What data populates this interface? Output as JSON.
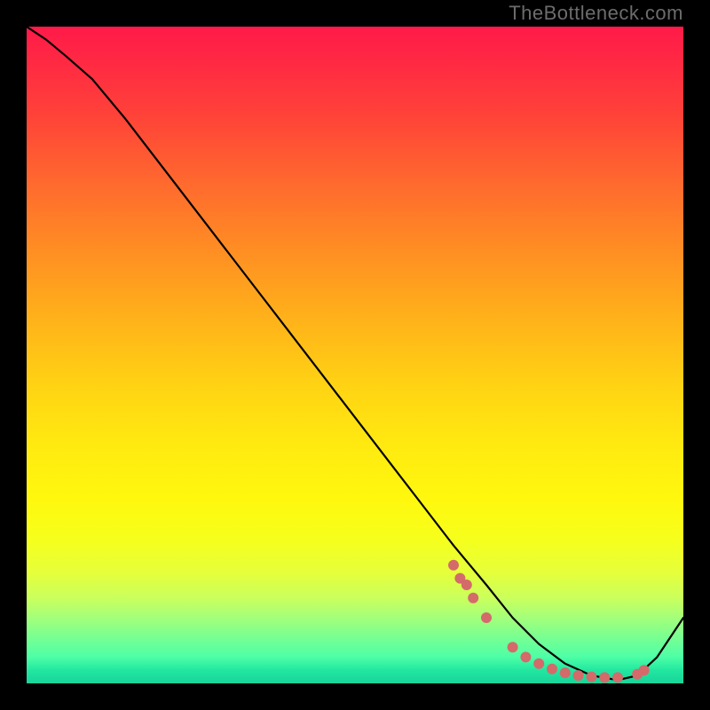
{
  "watermark": "TheBottleneck.com",
  "chart_data": {
    "type": "line",
    "title": "",
    "xlabel": "",
    "ylabel": "",
    "xlim": [
      0,
      100
    ],
    "ylim": [
      0,
      100
    ],
    "x": [
      0,
      3,
      6,
      10,
      15,
      20,
      25,
      30,
      35,
      40,
      45,
      50,
      55,
      60,
      65,
      70,
      74,
      78,
      82,
      86,
      90,
      93,
      96,
      100
    ],
    "values": [
      100,
      98,
      95.5,
      92,
      86,
      79.5,
      73,
      66.5,
      60,
      53.5,
      47,
      40.5,
      34,
      27.5,
      21,
      15,
      10,
      6,
      3,
      1.2,
      0.5,
      1.2,
      4,
      10
    ],
    "secondary_points": {
      "x": [
        65,
        66,
        67,
        68,
        70,
        74,
        76,
        78,
        80,
        82,
        84,
        86,
        88,
        90,
        93,
        94
      ],
      "y": [
        18,
        16,
        15,
        13,
        10,
        5.5,
        4,
        3,
        2.2,
        1.6,
        1.2,
        1,
        0.9,
        0.9,
        1.4,
        2
      ],
      "color": "#d46a6a"
    },
    "background_gradient": {
      "top": "#ff1a49",
      "mid": "#ffe810",
      "bottom": "#18d49a"
    }
  }
}
